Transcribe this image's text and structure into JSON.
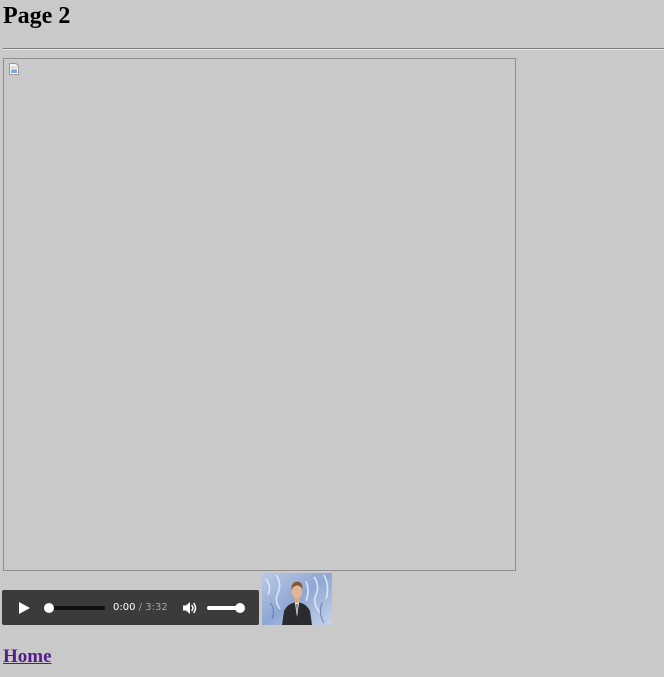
{
  "page": {
    "title": "Page 2"
  },
  "image": {
    "icon": "broken-image-icon"
  },
  "audio_player": {
    "current_time": "0:00",
    "separator": "/",
    "duration": "3:32",
    "progress_fraction": 0,
    "volume_fraction": 1,
    "play_icon": "play-icon",
    "volume_icon": "speaker-icon"
  },
  "thumbnail": {
    "description_icon": "video-thumbnail"
  },
  "links": {
    "home_label": "Home"
  },
  "colors": {
    "background": "#c9c9c9",
    "player_background": "#3b3b3b",
    "visited_link": "#551a8b"
  }
}
